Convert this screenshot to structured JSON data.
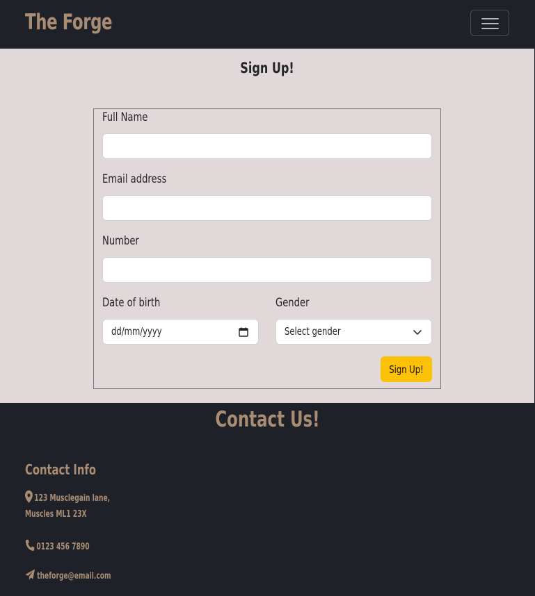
{
  "navbar": {
    "brand": "The Forge",
    "toggle_icon": "hamburger-menu-icon"
  },
  "signup": {
    "title": "Sign Up!",
    "full_name_label": "Full Name",
    "full_name_value": "",
    "email_label": "Email address",
    "email_value": "",
    "number_label": "Number",
    "number_value": "",
    "dob_label": "Date of birth",
    "dob_placeholder": "dd/mm/yyyy",
    "gender_label": "Gender",
    "gender_selected": "Select gender",
    "submit_label": "Sign Up!"
  },
  "contact": {
    "title": "Contact Us!",
    "subtitle": "Contact Info",
    "address_line1": "123 Musclegain lane,",
    "address_line2": "Muscles ML1 23X",
    "phone": "0123 456 7890",
    "email": "theforge@email.com",
    "icons": [
      "map-marker-icon",
      "phone-icon",
      "paper-plane-icon"
    ]
  },
  "colors": {
    "dark_bg": "#1f2128",
    "section_bg": "#e1d9d9",
    "accent": "#a98c74",
    "button": "#fdc107"
  }
}
